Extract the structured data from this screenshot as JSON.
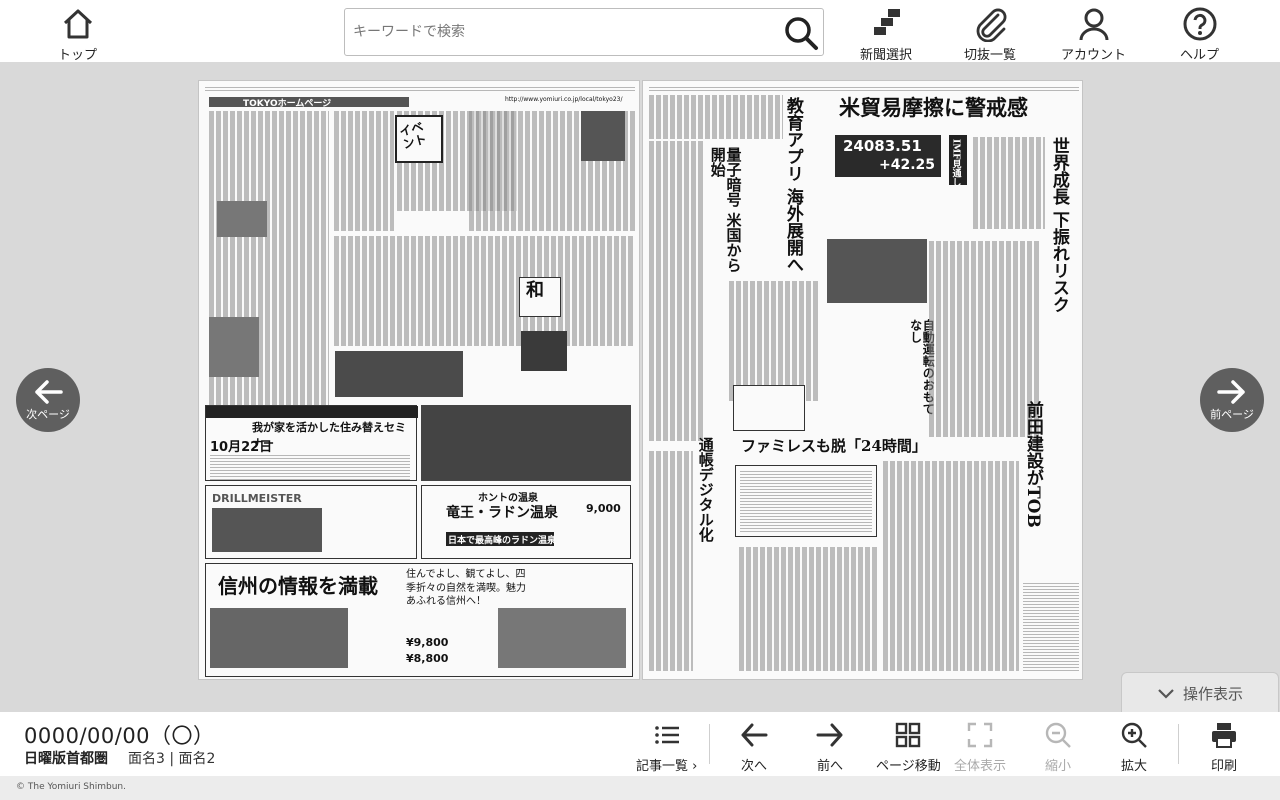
{
  "topbar": {
    "home_label": "トップ",
    "search_placeholder": "キーワードで検索",
    "paper_select_label": "新聞選択",
    "clippings_label": "切抜一覧",
    "account_label": "アカウント",
    "help_label": "ヘルプ"
  },
  "viewer": {
    "prev_label": "次ページ",
    "next_label": "前ページ",
    "ops_toggle_label": "操作表示",
    "left_page": {
      "header": "TOKYOホームページ",
      "url": "http://www.yomiuri.co.jp/local/tokyo23/",
      "ad_title_1": "我が家を活かした住み替えセミナー",
      "ad_date_1": "10月22日",
      "ad_brand": "DRILLMEISTER",
      "ad_onsen_sub": "ホントの温泉",
      "ad_onsen_title": "竜王・ラドン温泉",
      "ad_onsen_catch": "日本で最高峰のラドン温泉",
      "ad_onsen_price": "9,000",
      "ad_shinshu": "信州の情報を満載",
      "ad_shinshu_poem": "住んでよし、観てよし、四季折々の自然を満喫。魅力あふれる信州へ！",
      "ad_price_2": "¥9,800",
      "ad_price_3": "¥8,800"
    },
    "right_page": {
      "headline_main": "米貿易摩擦に警戒感",
      "headline_edu": "教育アプリ 海外展開へ",
      "headline_growth": "世界成長 下振れリスク",
      "ticker_1": "24083.51",
      "ticker_2": "+42.25",
      "imf_label": "IMF見通し",
      "headline_famires": "ファミレスも脱「24時間」",
      "headline_tob": "前田建設がTOB",
      "headline_quantum": "量子暗号 米国から開始",
      "headline_bank": "通帳デジタル化",
      "headline_self_driving": "自動運転のおもてなし"
    }
  },
  "bottombar": {
    "date": "0000/00/00（〇）",
    "edition": "日曜版首都圏",
    "page_names": "面名3 | 面名2",
    "articles_label": "記事一覧",
    "next_label": "次へ",
    "prev_label": "前へ",
    "page_move_label": "ページ移動",
    "fit_label": "全体表示",
    "zoom_out_label": "縮小",
    "zoom_in_label": "拡大",
    "print_label": "印刷"
  },
  "footer": {
    "copyright": "© The Yomiuri Shimbun."
  }
}
